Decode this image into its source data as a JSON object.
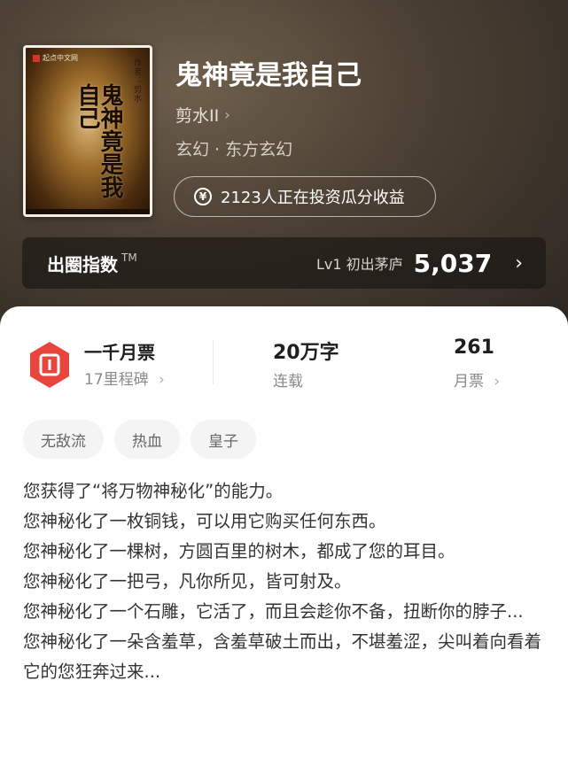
{
  "book": {
    "title": "鬼神竟是我自己",
    "author": "剪水II",
    "genre": "玄幻 · 东方玄幻",
    "invest_text": "2123人正在投资瓜分收益",
    "cover": {
      "badge": "起点中文网",
      "title_text": "鬼神竟是我自己",
      "side_text": "作者：剪水"
    }
  },
  "popularity": {
    "label": "出圈指数",
    "tm": "TM",
    "level": "Lv1 初出茅庐",
    "score": "5,037"
  },
  "stats": {
    "monthly_ticket": {
      "title": "一千月票",
      "subtitle": "17里程碑"
    },
    "words": {
      "value": "20万字",
      "label": "连载"
    },
    "tickets": {
      "value": "261",
      "label": "月票"
    }
  },
  "tags": [
    "无敌流",
    "热血",
    "皇子"
  ],
  "synopsis": [
    "您获得了“将万物神秘化”的能力。",
    "您神秘化了一枚铜钱，可以用它购买任何东西。",
    "您神秘化了一棵树，方圆百里的树木，都成了您的耳目。",
    "您神秘化了一把弓，凡你所见，皆可射及。",
    "您神秘化了一个石雕，它活了，而且会趁你不备，扭断你的脖子...",
    "您神秘化了一朵含羞草，含羞草破土而出，不堪羞涩，尖叫着向看着它的您狂奔过来..."
  ],
  "icons": {
    "chevron": "chevron-right-icon",
    "yen": "yen-circle-icon",
    "ticket": "ticket-badge-icon"
  },
  "colors": {
    "ticket_red": "#e8453c",
    "hero_dark": "#2c2621"
  }
}
